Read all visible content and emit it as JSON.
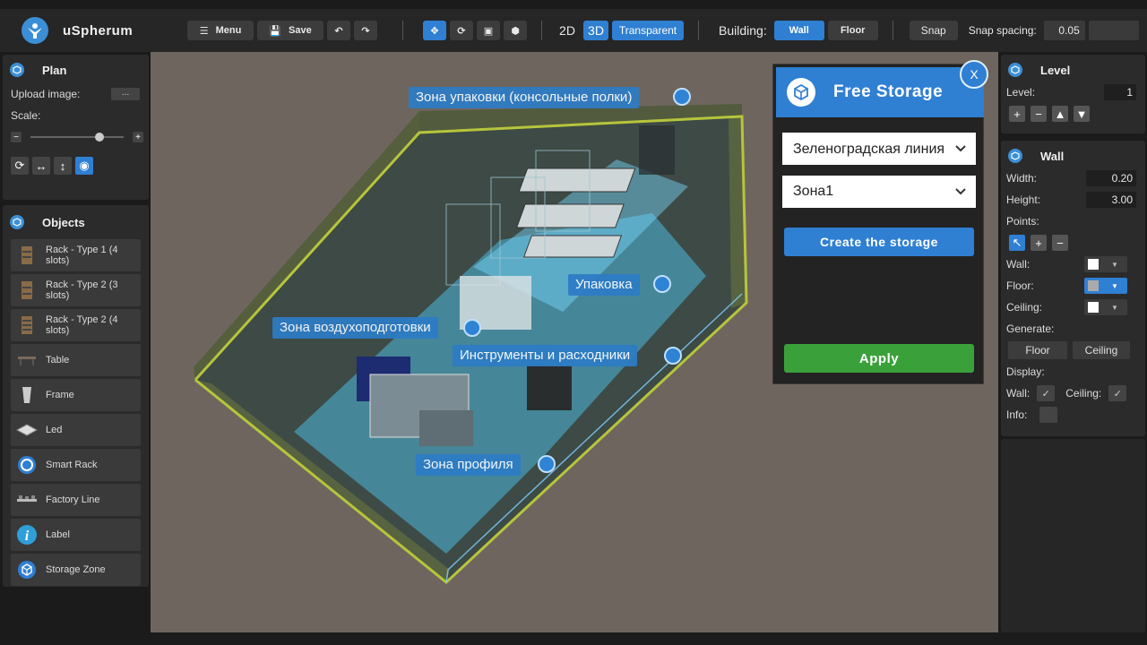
{
  "app": {
    "name": "uSpherum"
  },
  "toolbar": {
    "menu_label": "Menu",
    "save_label": "Save",
    "mode_2d": "2D",
    "mode_3d": "3D",
    "transparent_label": "Transparent",
    "building_label": "Building:",
    "wall_label": "Wall",
    "floor_label": "Floor",
    "snap_label": "Snap",
    "snap_spacing_label": "Snap spacing:",
    "snap_spacing_value": "0.05"
  },
  "plan": {
    "title": "Plan",
    "upload_label": "Upload image:",
    "upload_button": "...",
    "scale_label": "Scale:",
    "scale_level": 0.77
  },
  "objects": {
    "title": "Objects",
    "items": [
      {
        "label": "Rack - Type 1 (4 slots)",
        "icon": "rack-icon"
      },
      {
        "label": "Rack - Type 2 (3 slots)",
        "icon": "rack-icon"
      },
      {
        "label": "Rack - Type 2 (4 slots)",
        "icon": "rack-icon"
      },
      {
        "label": "Table",
        "icon": "table-icon"
      },
      {
        "label": "Frame",
        "icon": "frame-icon"
      },
      {
        "label": "Led",
        "icon": "led-icon"
      },
      {
        "label": "Smart Rack",
        "icon": "smart-rack-icon"
      },
      {
        "label": "Factory Line",
        "icon": "factory-line-icon"
      },
      {
        "label": "Label",
        "icon": "info-icon"
      },
      {
        "label": "Storage Zone",
        "icon": "cube-icon"
      }
    ]
  },
  "level": {
    "title": "Level",
    "label": "Level:",
    "value": "1"
  },
  "wall": {
    "title": "Wall",
    "width_label": "Width:",
    "width_value": "0.20",
    "height_label": "Height:",
    "height_value": "3.00",
    "points_label": "Points:",
    "wall_color_label": "Wall:",
    "floor_color_label": "Floor:",
    "ceiling_color_label": "Ceiling:",
    "generate_label": "Generate:",
    "gen_floor": "Floor",
    "gen_ceiling": "Ceiling",
    "display_label": "Display:",
    "display_wall": "Wall:",
    "display_ceiling": "Ceiling:",
    "info_label": "Info:"
  },
  "viewport": {
    "zone_labels": [
      "Зона упаковки (консольные полки)",
      "Упаковка",
      "Зона воздухоподготовки",
      "Инструменты и расходники",
      "Зона профиля"
    ]
  },
  "dialog": {
    "title": "Free Storage",
    "close_label": "X",
    "line_select": "Зеленоградская линия",
    "zone_select": "Зона1",
    "create_label": "Create the storage",
    "apply_label": "Apply"
  },
  "colors": {
    "accent": "#2f7fd3",
    "apply": "#3aa13a",
    "viewport_bg": "#6e665e",
    "zone_fill": "#4fd0ff",
    "wall_edge": "#b6c53c"
  }
}
